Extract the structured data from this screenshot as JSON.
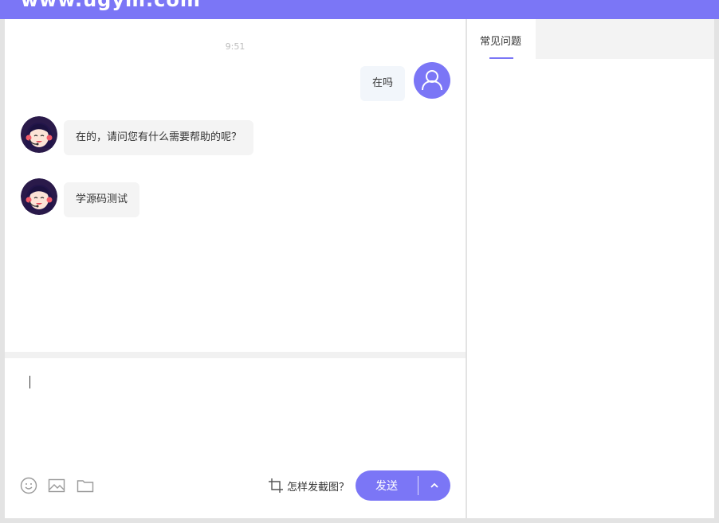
{
  "header": {
    "title": "www.ugym.com"
  },
  "chat": {
    "timestamp": "9:51",
    "messages": [
      {
        "from": "user",
        "text": "在吗"
      },
      {
        "from": "agent",
        "text": "在的，请问您有什么需要帮助的呢？"
      },
      {
        "from": "agent",
        "text": "学源码测试"
      }
    ]
  },
  "composer": {
    "value": "",
    "toolbar_icons": [
      "emoji-icon",
      "image-icon",
      "folder-icon"
    ],
    "screenshot_help": "怎样发截图？",
    "send_label": "发送"
  },
  "sidebar": {
    "tabs": [
      {
        "label": "常见问题",
        "active": true
      }
    ]
  },
  "colors": {
    "accent": "#7b76f6"
  }
}
